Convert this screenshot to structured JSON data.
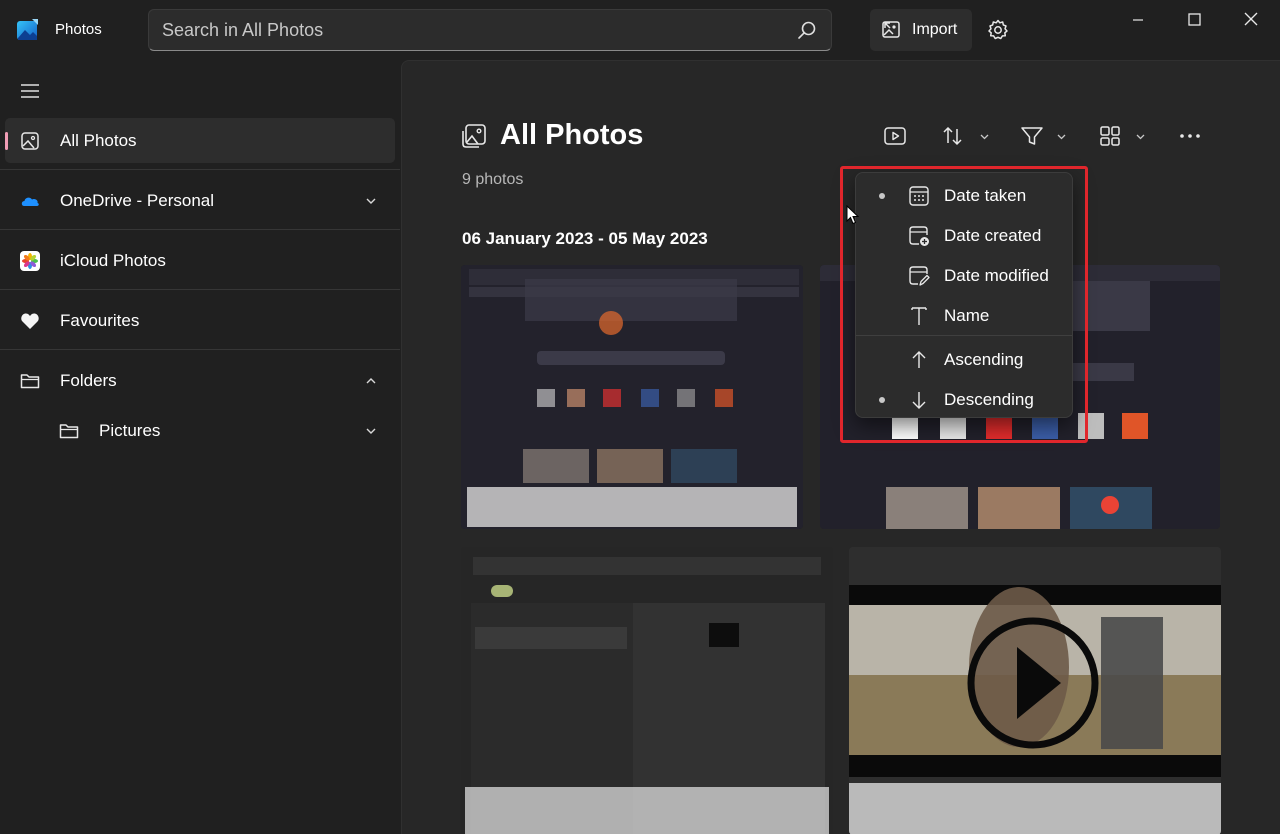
{
  "app": {
    "title": "Photos"
  },
  "search": {
    "placeholder": "Search in All Photos"
  },
  "toolbar": {
    "import_label": "Import"
  },
  "sidebar": {
    "items": [
      {
        "label": "All Photos"
      },
      {
        "label": "OneDrive - Personal"
      },
      {
        "label": "iCloud Photos"
      },
      {
        "label": "Favourites"
      },
      {
        "label": "Folders"
      },
      {
        "label": "Pictures"
      }
    ]
  },
  "main": {
    "title": "All Photos",
    "count": "9 photos",
    "date_range": "06 January 2023 - 05 May 2023"
  },
  "sort_menu": {
    "items": [
      {
        "label": "Date taken",
        "icon": "calendar-icon",
        "selected": true
      },
      {
        "label": "Date created",
        "icon": "calendar-add-icon",
        "selected": false
      },
      {
        "label": "Date modified",
        "icon": "calendar-edit-icon",
        "selected": false
      },
      {
        "label": "Name",
        "icon": "text-icon",
        "selected": false
      },
      {
        "label": "Ascending",
        "icon": "arrow-up-icon",
        "selected": false
      },
      {
        "label": "Descending",
        "icon": "arrow-down-icon",
        "selected": true
      }
    ]
  },
  "colors": {
    "accent_indicator": "#f09db5",
    "highlight_box": "#e0262c",
    "background": "#202020"
  }
}
